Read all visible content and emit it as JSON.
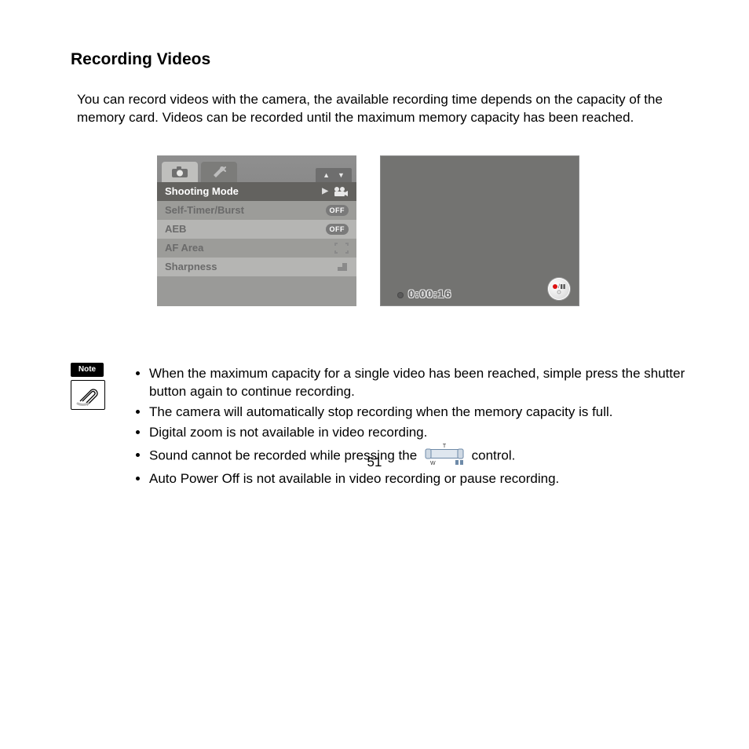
{
  "title": "Recording Videos",
  "intro": "You can record videos with the camera, the available recording time depends on the capacity of the memory card. Videos can be recorded until the maximum memory capacity has been reached.",
  "menu": {
    "rows": [
      {
        "label": "Shooting Mode",
        "value_kind": "video-icon",
        "selected": true
      },
      {
        "label": "Self-Timer/Burst",
        "value_kind": "off",
        "value_text": "OFF"
      },
      {
        "label": "AEB",
        "value_kind": "off",
        "value_text": "OFF"
      },
      {
        "label": "AF Area",
        "value_kind": "af-icon"
      },
      {
        "label": "Sharpness",
        "value_kind": "sharp-icon"
      }
    ]
  },
  "recording": {
    "time": "0:00:16"
  },
  "note_label": "Note",
  "notes": {
    "n1": "When the maximum capacity for a single video has been reached, simple press the shutter button again to continue recording.",
    "n2": "The camera will automatically stop recording when the memory capacity is full.",
    "n3": "Digital zoom is not available in video recording.",
    "n4a": "Sound cannot be recorded while pressing the ",
    "n4b": " control.",
    "n5": "Auto Power Off is not available in video recording or pause recording."
  },
  "page_number": "51"
}
